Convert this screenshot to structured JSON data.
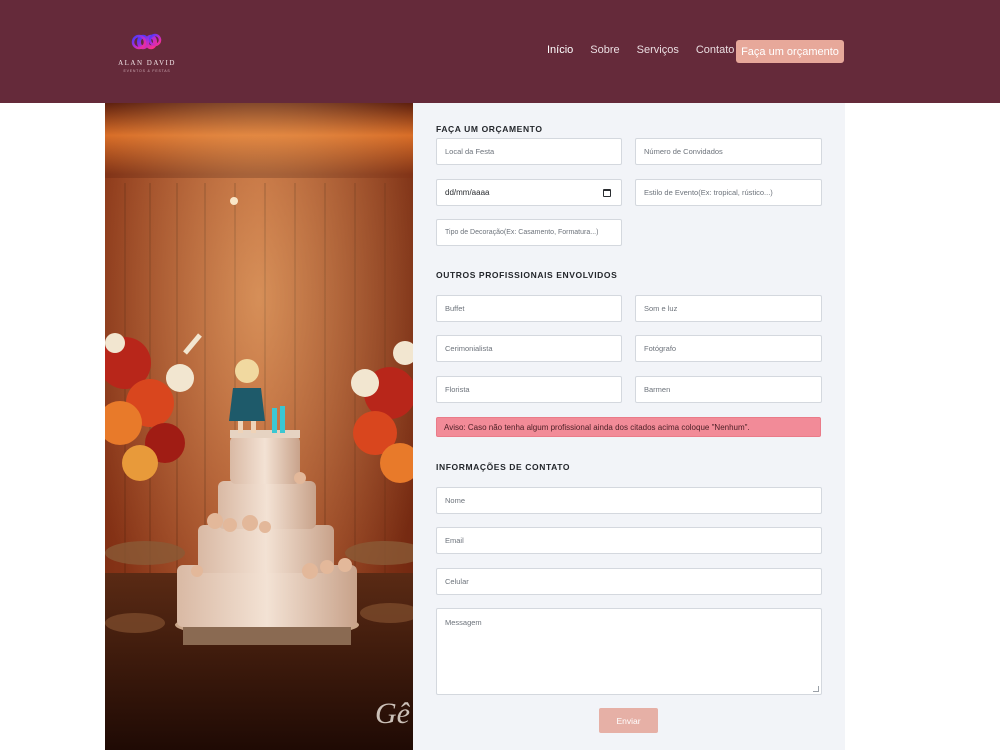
{
  "brand": {
    "name": "ALAN DAVID",
    "tagline": "EVENTOS & FESTAS"
  },
  "nav": {
    "items": [
      "Início",
      "Sobre",
      "Serviços",
      "Contato"
    ],
    "cta": "Faça um orçamento"
  },
  "photo": {
    "subject": "wedding cake with topper doll and flowers",
    "watermark": "Gê"
  },
  "form": {
    "section1_title": "FAÇA UM ORÇAMENTO",
    "local_placeholder": "Local da Festa",
    "convidados_placeholder": "Número de Convidados",
    "date_value": "dd/mm/aaaa",
    "estilo_placeholder": "Estilo de Evento(Ex: tropical, rústico...)",
    "decoracao_placeholder": "Tipo de Decoração(Ex: Casamento, Formatura...)",
    "section2_title": "OUTROS PROFISSIONAIS ENVOLVIDOS",
    "buffet_placeholder": "Buffet",
    "som_placeholder": "Som e luz",
    "cerimonialista_placeholder": "Cerimonialista",
    "fotografo_placeholder": "Fotógrafo",
    "florista_placeholder": "Florista",
    "barmen_placeholder": "Barmen",
    "warning": "Aviso: Caso não tenha algum profissional ainda dos citados acima coloque \"Nenhum\".",
    "section3_title": "INFORMAÇÕES DE CONTATO",
    "nome_placeholder": "Nome",
    "email_placeholder": "Email",
    "celular_placeholder": "Celular",
    "mensagem_placeholder": "Messagem",
    "submit_label": "Enviar"
  },
  "colors": {
    "header_bg": "#652a3a",
    "cta_bg": "#e7a89a",
    "panel_bg": "#f2f4f8",
    "warning_bg": "#f28b98",
    "submit_bg": "#e6b0a6"
  }
}
